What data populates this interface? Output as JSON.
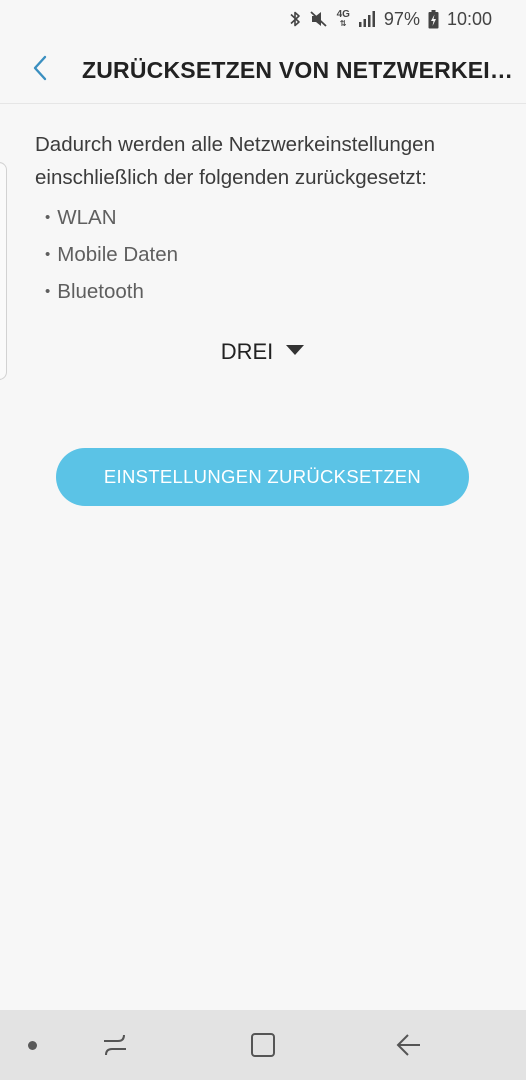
{
  "status_bar": {
    "network": "4G",
    "battery": "97%",
    "time": "10:00"
  },
  "app_bar": {
    "title": "ZURÜCKSETZEN VON NETZWERKEINSTELLUNGEN"
  },
  "content": {
    "description": "Dadurch werden alle Netzwerkeinstellungen einschließlich der folgenden zurückgesetzt:",
    "items": [
      "WLAN",
      "Mobile Daten",
      "Bluetooth"
    ],
    "bullet": "•"
  },
  "sim_selector": {
    "selected": "DREI"
  },
  "reset_button": {
    "label": "EINSTELLUNGEN ZURÜCKSETZEN",
    "color": "#5bc3e6"
  },
  "icons": {
    "back": "chevron-left-icon",
    "bluetooth": "bluetooth-icon",
    "mute": "mute-icon",
    "signal": "signal-icon",
    "battery": "battery-charging-icon",
    "dropdown": "caret-down-icon",
    "recents": "recents-icon",
    "home": "home-icon",
    "nav_back": "back-arrow-icon"
  }
}
